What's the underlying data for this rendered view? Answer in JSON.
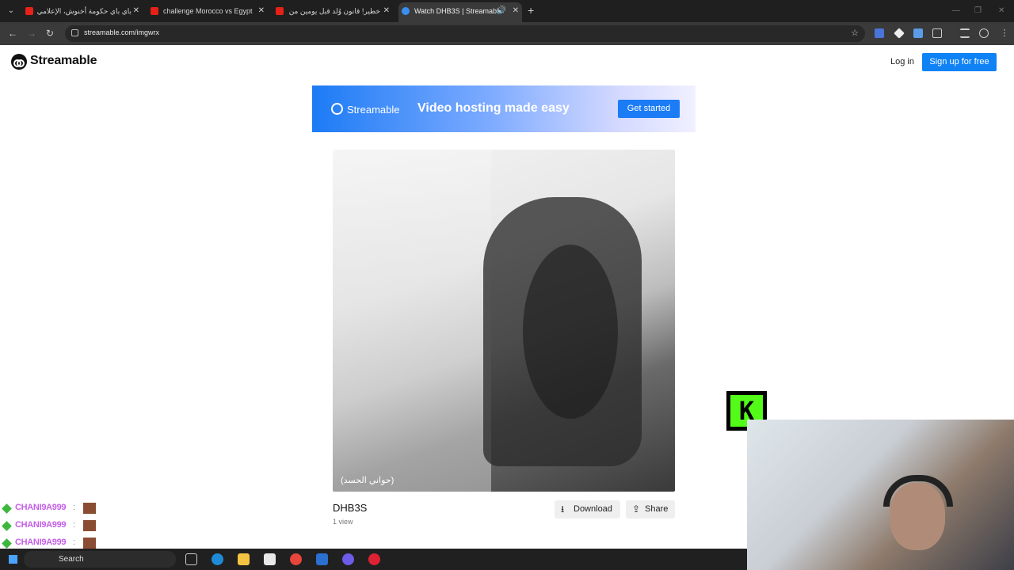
{
  "browser": {
    "tabs": [
      {
        "title": "باي باي حكومة أخنوش، الإعلامي"
      },
      {
        "title": "challenge Morocco vs Egypt"
      },
      {
        "title": "خطير! قانون وُلد قبل يومين من"
      },
      {
        "title": "Watch DHB3S | Streamable"
      }
    ],
    "url": "streamable.com/imgwrx"
  },
  "header": {
    "logo": "Streamable",
    "login": "Log in",
    "signup": "Sign up for free"
  },
  "banner": {
    "brand": "Streamable",
    "tagline": "Video hosting made easy",
    "cta": "Get started"
  },
  "video": {
    "caption": "(حواني الحسد)",
    "title": "DHB3S",
    "views": "1 view",
    "download": "Download",
    "share": "Share"
  },
  "overlay": {
    "chat_user": "CHANI9A999",
    "chat_sep": ":"
  },
  "taskbar": {
    "search": "Search"
  },
  "colors": {
    "accent": "#0f82f5",
    "chat_name": "#c65fe8",
    "kick": "#53fc18"
  }
}
